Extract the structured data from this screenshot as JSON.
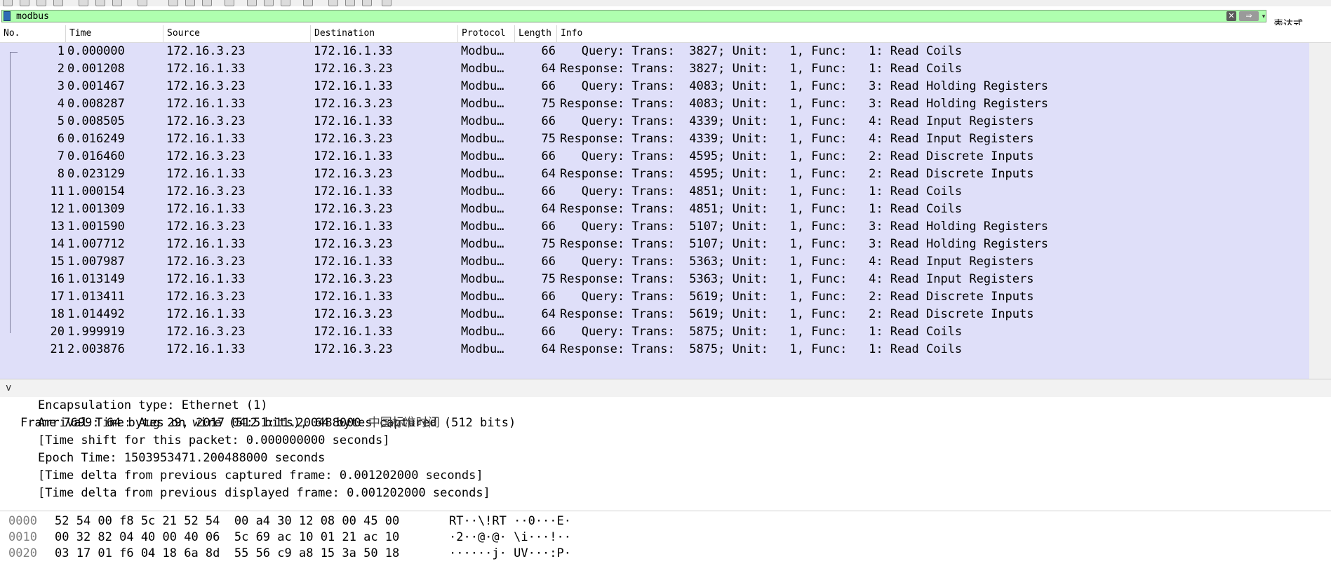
{
  "filter": {
    "value": "modbus",
    "clear_label": "✕",
    "apply_label": "⇒",
    "dropdown_label": "▾",
    "expression_label": "表达式…"
  },
  "packet_list": {
    "columns": [
      "No.",
      "Time",
      "Source",
      "Destination",
      "Protocol",
      "Length",
      "Info"
    ],
    "rows": [
      {
        "no": "1",
        "time": "0.000000",
        "src": "172.16.3.23",
        "dst": "172.16.1.33",
        "proto": "Modbu…",
        "len": "66",
        "info": "   Query: Trans:  3827; Unit:   1, Func:   1: Read Coils"
      },
      {
        "no": "2",
        "time": "0.001208",
        "src": "172.16.1.33",
        "dst": "172.16.3.23",
        "proto": "Modbu…",
        "len": "64",
        "info": "Response: Trans:  3827; Unit:   1, Func:   1: Read Coils"
      },
      {
        "no": "3",
        "time": "0.001467",
        "src": "172.16.3.23",
        "dst": "172.16.1.33",
        "proto": "Modbu…",
        "len": "66",
        "info": "   Query: Trans:  4083; Unit:   1, Func:   3: Read Holding Registers"
      },
      {
        "no": "4",
        "time": "0.008287",
        "src": "172.16.1.33",
        "dst": "172.16.3.23",
        "proto": "Modbu…",
        "len": "75",
        "info": "Response: Trans:  4083; Unit:   1, Func:   3: Read Holding Registers"
      },
      {
        "no": "5",
        "time": "0.008505",
        "src": "172.16.3.23",
        "dst": "172.16.1.33",
        "proto": "Modbu…",
        "len": "66",
        "info": "   Query: Trans:  4339; Unit:   1, Func:   4: Read Input Registers"
      },
      {
        "no": "6",
        "time": "0.016249",
        "src": "172.16.1.33",
        "dst": "172.16.3.23",
        "proto": "Modbu…",
        "len": "75",
        "info": "Response: Trans:  4339; Unit:   1, Func:   4: Read Input Registers"
      },
      {
        "no": "7",
        "time": "0.016460",
        "src": "172.16.3.23",
        "dst": "172.16.1.33",
        "proto": "Modbu…",
        "len": "66",
        "info": "   Query: Trans:  4595; Unit:   1, Func:   2: Read Discrete Inputs"
      },
      {
        "no": "8",
        "time": "0.023129",
        "src": "172.16.1.33",
        "dst": "172.16.3.23",
        "proto": "Modbu…",
        "len": "64",
        "info": "Response: Trans:  4595; Unit:   1, Func:   2: Read Discrete Inputs"
      },
      {
        "no": "11",
        "time": "1.000154",
        "src": "172.16.3.23",
        "dst": "172.16.1.33",
        "proto": "Modbu…",
        "len": "66",
        "info": "   Query: Trans:  4851; Unit:   1, Func:   1: Read Coils"
      },
      {
        "no": "12",
        "time": "1.001309",
        "src": "172.16.1.33",
        "dst": "172.16.3.23",
        "proto": "Modbu…",
        "len": "64",
        "info": "Response: Trans:  4851; Unit:   1, Func:   1: Read Coils"
      },
      {
        "no": "13",
        "time": "1.001590",
        "src": "172.16.3.23",
        "dst": "172.16.1.33",
        "proto": "Modbu…",
        "len": "66",
        "info": "   Query: Trans:  5107; Unit:   1, Func:   3: Read Holding Registers"
      },
      {
        "no": "14",
        "time": "1.007712",
        "src": "172.16.1.33",
        "dst": "172.16.3.23",
        "proto": "Modbu…",
        "len": "75",
        "info": "Response: Trans:  5107; Unit:   1, Func:   3: Read Holding Registers"
      },
      {
        "no": "15",
        "time": "1.007987",
        "src": "172.16.3.23",
        "dst": "172.16.1.33",
        "proto": "Modbu…",
        "len": "66",
        "info": "   Query: Trans:  5363; Unit:   1, Func:   4: Read Input Registers"
      },
      {
        "no": "16",
        "time": "1.013149",
        "src": "172.16.1.33",
        "dst": "172.16.3.23",
        "proto": "Modbu…",
        "len": "75",
        "info": "Response: Trans:  5363; Unit:   1, Func:   4: Read Input Registers"
      },
      {
        "no": "17",
        "time": "1.013411",
        "src": "172.16.3.23",
        "dst": "172.16.1.33",
        "proto": "Modbu…",
        "len": "66",
        "info": "   Query: Trans:  5619; Unit:   1, Func:   2: Read Discrete Inputs"
      },
      {
        "no": "18",
        "time": "1.014492",
        "src": "172.16.1.33",
        "dst": "172.16.3.23",
        "proto": "Modbu…",
        "len": "64",
        "info": "Response: Trans:  5619; Unit:   1, Func:   2: Read Discrete Inputs"
      },
      {
        "no": "20",
        "time": "1.999919",
        "src": "172.16.3.23",
        "dst": "172.16.1.33",
        "proto": "Modbu…",
        "len": "66",
        "info": "   Query: Trans:  5875; Unit:   1, Func:   1: Read Coils"
      },
      {
        "no": "21",
        "time": "2.003876",
        "src": "172.16.1.33",
        "dst": "172.16.3.23",
        "proto": "Modbu…",
        "len": "64",
        "info": "Response: Trans:  5875; Unit:   1, Func:   1: Read Coils"
      }
    ]
  },
  "details": {
    "expand_glyph": "v",
    "frame_summary": "Frame 7699: 64 bytes on wire (512 bits), 64 bytes captured (512 bits)",
    "lines": [
      "Encapsulation type: Ethernet (1)",
      "Arrival Time: Aug 29, 2017 04:51:11.200488000 ",
      "[Time shift for this packet: 0.000000000 seconds]",
      "Epoch Time: 1503953471.200488000 seconds",
      "[Time delta from previous captured frame: 0.001202000 seconds]",
      "[Time delta from previous displayed frame: 0.001202000 seconds]"
    ],
    "arrival_timezone": "中国标准时间"
  },
  "bytes": {
    "rows": [
      {
        "offset": "0000",
        "hex": "52 54 00 f8 5c 21 52 54  00 a4 30 12 08 00 45 00",
        "ascii": "RT··\\!RT ··0···E·"
      },
      {
        "offset": "0010",
        "hex": "00 32 82 04 40 00 40 06  5c 69 ac 10 01 21 ac 10",
        "ascii": "·2··@·@· \\i···!··"
      },
      {
        "offset": "0020",
        "hex": "03 17 01 f6 04 18 6a 8d  55 56 c9 a8 15 3a 50 18",
        "ascii": "······j· UV···:P·"
      }
    ]
  }
}
